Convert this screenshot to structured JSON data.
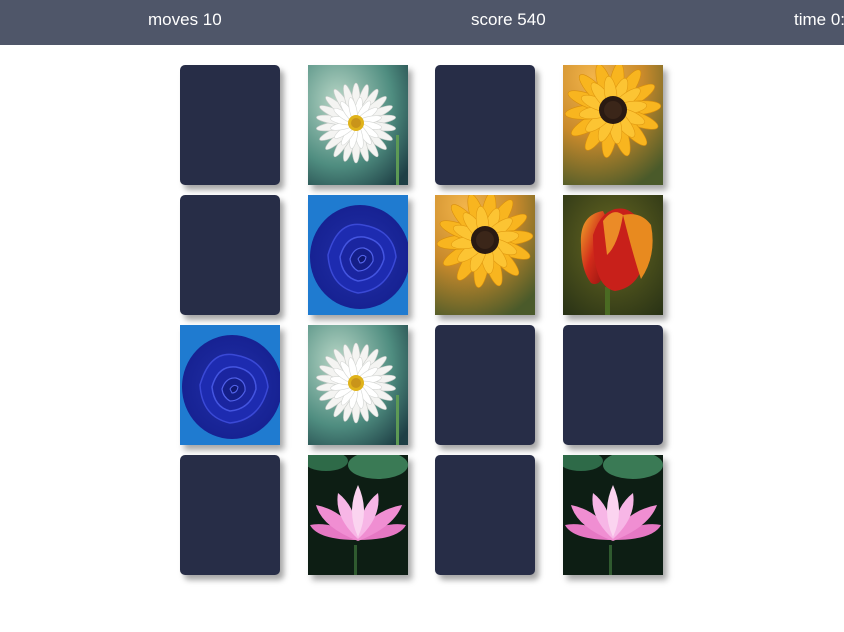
{
  "stats": {
    "moves_label": "moves 10",
    "score_label": "score 540",
    "time_label": "time 0:"
  },
  "colors": {
    "topbar": "#4f5669",
    "card_back": "#272d47"
  },
  "board": {
    "rows": 4,
    "cols": 4,
    "cards": [
      {
        "state": "hidden",
        "flower": null
      },
      {
        "state": "revealed",
        "flower": "daisy"
      },
      {
        "state": "hidden",
        "flower": null
      },
      {
        "state": "revealed",
        "flower": "sunflower"
      },
      {
        "state": "hidden",
        "flower": null
      },
      {
        "state": "revealed",
        "flower": "blue-rose"
      },
      {
        "state": "revealed",
        "flower": "sunflower"
      },
      {
        "state": "revealed",
        "flower": "tulip"
      },
      {
        "state": "revealed",
        "flower": "blue-rose"
      },
      {
        "state": "revealed",
        "flower": "daisy"
      },
      {
        "state": "hidden",
        "flower": null
      },
      {
        "state": "hidden",
        "flower": null
      },
      {
        "state": "hidden",
        "flower": null
      },
      {
        "state": "revealed",
        "flower": "lotus"
      },
      {
        "state": "hidden",
        "flower": null
      },
      {
        "state": "revealed",
        "flower": "lotus"
      }
    ]
  }
}
